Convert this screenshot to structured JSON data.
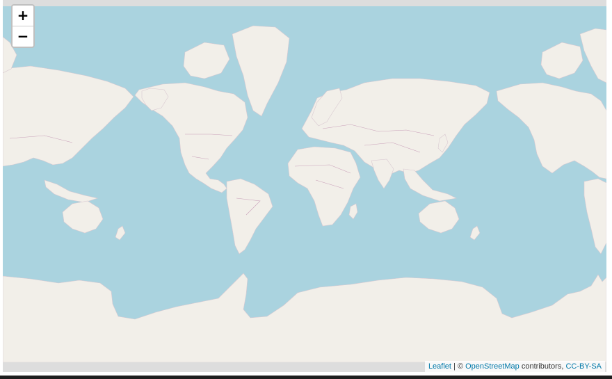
{
  "map": {
    "ocean_color": "#aad3df",
    "land_color": "#f2efe9",
    "border_color": "#c9a0b9",
    "frame_color": "#dddddd"
  },
  "zoom": {
    "in_label": "+",
    "out_label": "−"
  },
  "attribution": {
    "leaflet_link": "Leaflet",
    "separator": "| ©",
    "osm_link": "OpenStreetMap",
    "contributors_text": "contributors,",
    "license_link": "CC-BY-SA"
  }
}
